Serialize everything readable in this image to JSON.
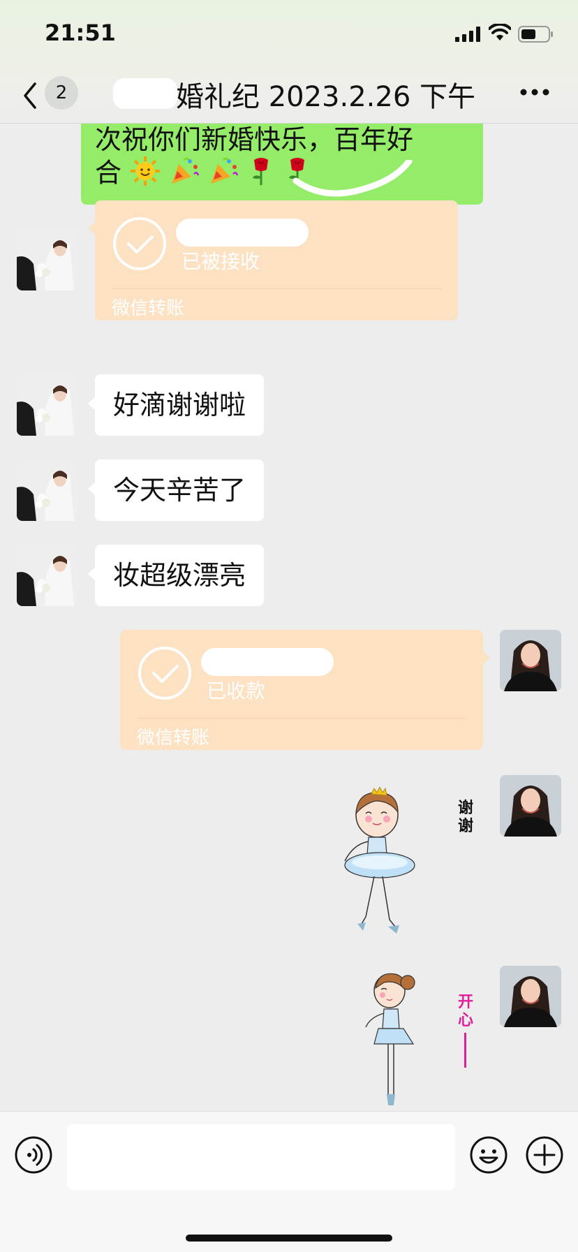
{
  "status_bar": {
    "time": "21:51"
  },
  "header": {
    "unread_count": "2",
    "title": "婚礼纪 2023.2.26 下午"
  },
  "messages": {
    "green_bubble": {
      "line1": "次祝你们新婚快乐，百年好",
      "line2": "合",
      "emojis": [
        "sun-with-face",
        "party-popper",
        "party-popper",
        "rose",
        "rose"
      ]
    },
    "transfer_received": {
      "status": "已被接收",
      "brand": "微信转账"
    },
    "text1": "好滴谢谢啦",
    "text2": "今天辛苦了",
    "text3": "妆超级漂亮",
    "transfer_collected": {
      "status": "已收款",
      "brand": "微信转账"
    },
    "sticker1": {
      "caption": "谢谢",
      "caption_color": "#111111"
    },
    "sticker2": {
      "caption": "开心",
      "caption_color": "#e0209a"
    }
  },
  "input_bar": {
    "placeholder": ""
  },
  "colors": {
    "sent_bubble": "#95ec69",
    "transfer_card": "#fce1c2",
    "chat_background": "#ededed"
  }
}
